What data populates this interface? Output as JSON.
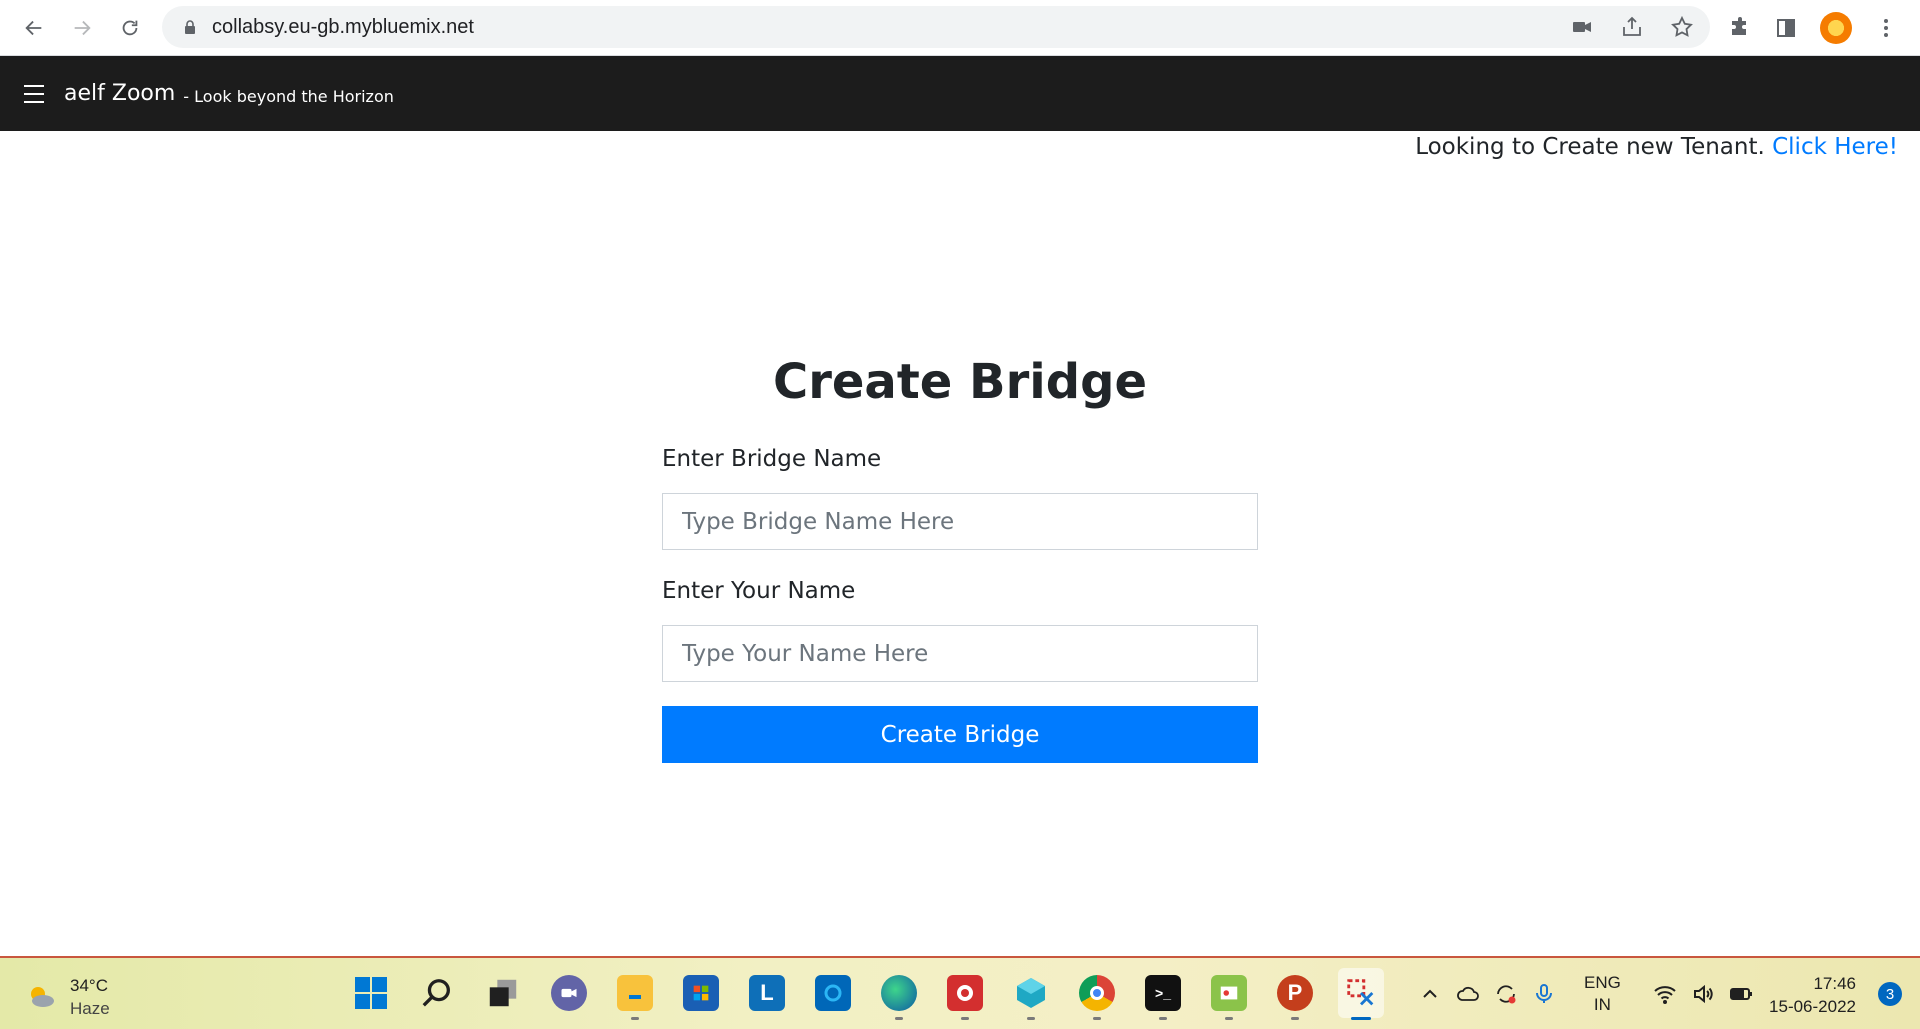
{
  "browser": {
    "url": "collabsy.eu-gb.mybluemix.net"
  },
  "navbar": {
    "brand": "aelf Zoom",
    "tagline": "- Look beyond the Horizon"
  },
  "tenant": {
    "text": "Looking to Create new Tenant.",
    "link": "Click Here!"
  },
  "form": {
    "title": "Create Bridge",
    "bridge_label": "Enter Bridge Name",
    "bridge_placeholder": "Type Bridge Name Here",
    "bridge_value": "",
    "name_label": "Enter Your Name",
    "name_placeholder": "Type Your Name Here",
    "name_value": "",
    "submit_label": "Create Bridge"
  },
  "taskbar": {
    "weather_temp": "34°C",
    "weather_desc": "Haze",
    "apps": [
      "windows-start-icon",
      "search-icon",
      "task-view-icon",
      "teams-chat-icon",
      "file-explorer-icon",
      "microsoft-store-icon",
      "l-app-icon",
      "cortana-icon",
      "edge-icon",
      "screen-recorder-icon",
      "3d-viewer-icon",
      "chrome-icon",
      "terminal-icon",
      "paint-icon",
      "powerpoint-icon",
      "snipping-tool-icon"
    ],
    "lang_line1": "ENG",
    "lang_line2": "IN",
    "time": "17:46",
    "date": "15-06-2022",
    "notification_count": "3"
  },
  "colors": {
    "primary": "#007bff",
    "navbar_bg": "#1c1c1c"
  }
}
